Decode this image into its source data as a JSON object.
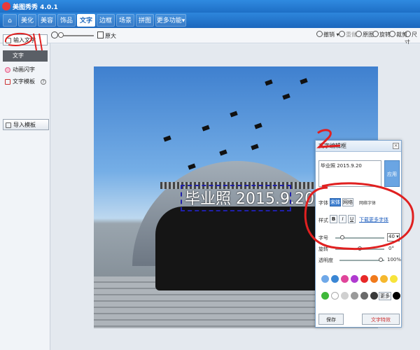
{
  "app": {
    "title": "美图秀秀 4.0.1"
  },
  "menu": {
    "tabs": [
      {
        "label": "美化"
      },
      {
        "label": "美容"
      },
      {
        "label": "饰品"
      },
      {
        "label": "文字"
      },
      {
        "label": "边框"
      },
      {
        "label": "场景"
      },
      {
        "label": "拼图"
      },
      {
        "label": "更多功能▾"
      }
    ],
    "active_index": 3
  },
  "toolbar": {
    "original_label": "原大",
    "undo_label": "撤销",
    "redo_label": "重做",
    "original_view_label": "原图",
    "rotate_label": "旋转",
    "crop_label": "裁剪",
    "size_label": "尺寸"
  },
  "left_panel": {
    "input_text_label": "输入文字",
    "active_item_label": "文字",
    "anim_label": "动画闪字",
    "template_label": "文字模板",
    "import_label": "导入模板"
  },
  "photo": {
    "caption": "毕业照 2015.9.20"
  },
  "editor": {
    "title": "文字编辑框",
    "content": "毕业照 2015.9.20",
    "apply_label": "应用",
    "font_label": "字体",
    "font_opt1": "宋体",
    "font_opt2": "网络",
    "font_opt3": "网络字体",
    "style_label": "样式",
    "bold": "B",
    "italic": "I",
    "underline": "U",
    "download_link": "下载更多字体",
    "size_label": "字号",
    "size_value": "40",
    "rotate_label": "旋转",
    "rotate_value": "0°",
    "opacity_label": "透明度",
    "opacity_value": "100%",
    "more_label": "更多",
    "footer_left": "保存",
    "footer_right": "文字特效"
  },
  "colors": {
    "brand": "#1e6fc6",
    "swatches": [
      "#6fa8e8",
      "#3a86d4",
      "#e0459a",
      "#b03ad0",
      "#e82828",
      "#f07a1c",
      "#f5b82e",
      "#f7e43c",
      "#3fb83a",
      "#ffffff",
      "#d0d0d0",
      "#9a9a9a",
      "#6a6a6a",
      "#3a3a3a",
      "#000000"
    ]
  },
  "annotations": {
    "mark1": "1",
    "mark2": "2"
  }
}
